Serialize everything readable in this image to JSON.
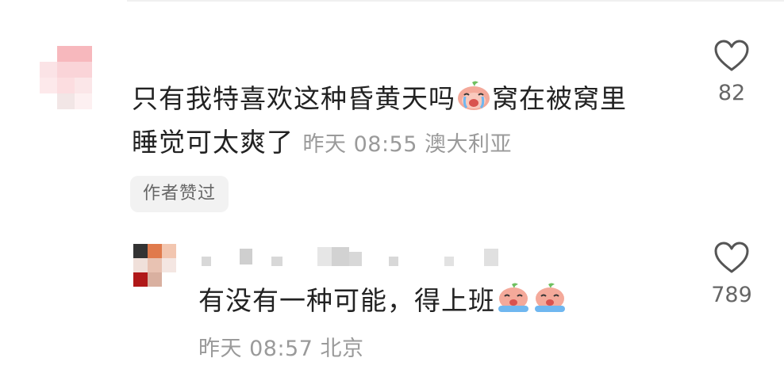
{
  "comments": [
    {
      "text_line1": "只有我特喜欢这种昏黄天吗",
      "text_line1_tail": "窝在被窝里",
      "text_line2": "睡觉可太爽了",
      "meta": "昨天 08:55 澳大利亚",
      "badge": "作者赞过",
      "likes": "82",
      "emoji": "crying-peach-emoji"
    },
    {
      "text": "有没有一种可能，得上班",
      "meta": "昨天 08:57 北京",
      "likes": "789",
      "emoji": "crying-peach-emoji"
    }
  ],
  "colors": {
    "text": "#222222",
    "meta": "#9a9a9a",
    "badge_bg": "#f2f2f2",
    "peach": "#f4a99a",
    "leaf": "#6fc060",
    "tear": "#6fb7f0"
  }
}
